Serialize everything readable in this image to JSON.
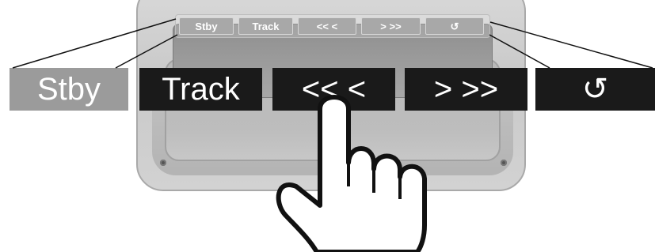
{
  "small_buttons": [
    {
      "label": "Stby"
    },
    {
      "label": "Track"
    },
    {
      "label": "<<   <"
    },
    {
      "label": ">   >>"
    },
    {
      "label": "↺"
    }
  ],
  "big_buttons": [
    {
      "label": "Stby",
      "state": "inactive"
    },
    {
      "label": "Track",
      "state": "active"
    },
    {
      "label": "<<  <",
      "state": "active"
    },
    {
      "label": ">  >>",
      "state": "active"
    },
    {
      "label": "↺",
      "state": "active"
    }
  ],
  "colors": {
    "inactive": "#9b9b9b",
    "active": "#1a1a1a",
    "text": "#ffffff"
  },
  "icons": [
    "hand-pointer-icon",
    "rotate-arrow-icon"
  ]
}
